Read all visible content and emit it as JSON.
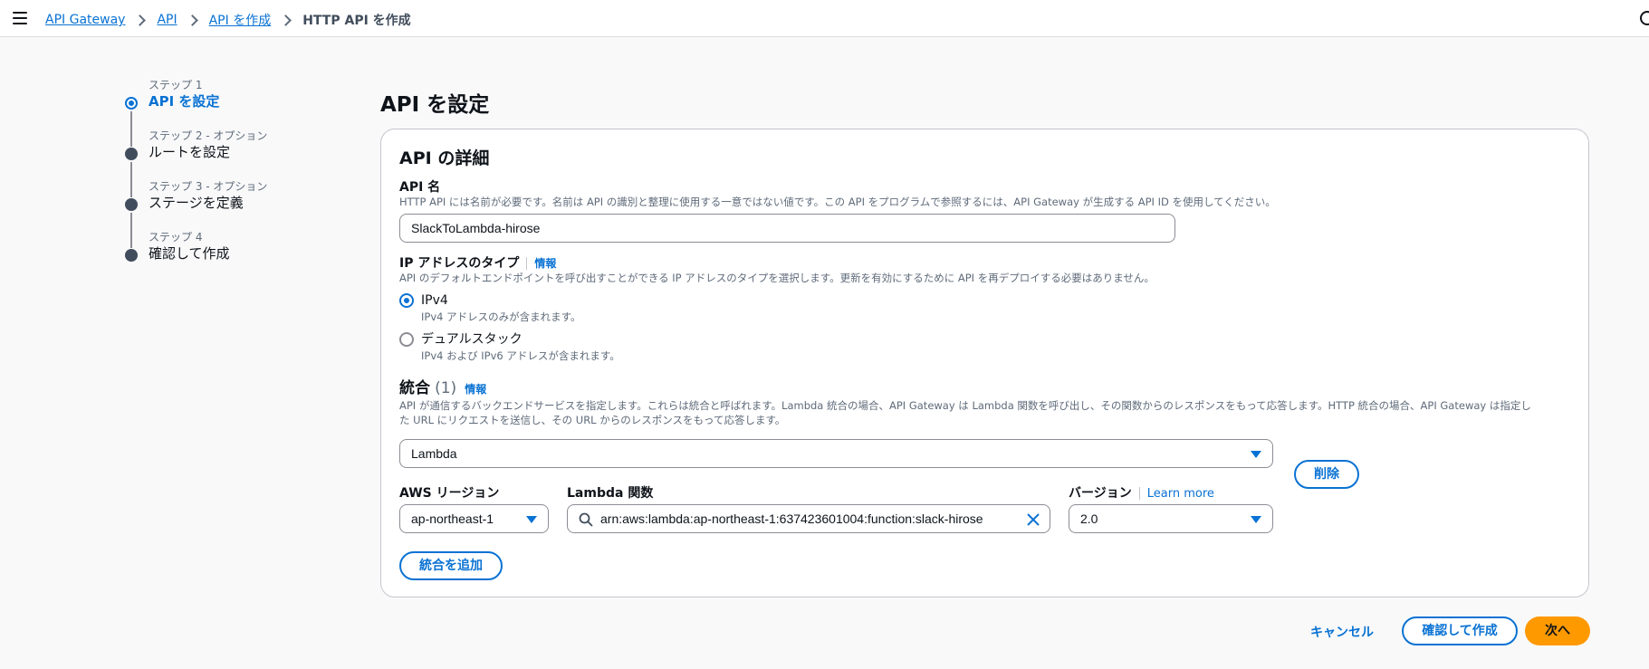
{
  "breadcrumb": {
    "items": [
      "API Gateway",
      "API",
      "API を作成"
    ],
    "current": "HTTP API を作成"
  },
  "steps": [
    {
      "meta": "ステップ 1",
      "title": "API を設定",
      "active": true
    },
    {
      "meta": "ステップ 2 - オプション",
      "title": "ルートを設定",
      "active": false
    },
    {
      "meta": "ステップ 3 - オプション",
      "title": "ステージを定義",
      "active": false
    },
    {
      "meta": "ステップ 4",
      "title": "確認して作成",
      "active": false
    }
  ],
  "page": {
    "title": "API を設定"
  },
  "details": {
    "title": "API の詳細",
    "api_name_label": "API 名",
    "api_name_desc": "HTTP API には名前が必要です。名前は API の識別と整理に使用する一意ではない値です。この API をプログラムで参照するには、API Gateway が生成する API ID を使用してください。",
    "api_name_value": "SlackToLambda-hirose",
    "ip_type_label": "IP アドレスのタイプ",
    "info": "情報",
    "ip_type_desc": "API のデフォルトエンドポイントを呼び出すことができる IP アドレスのタイプを選択します。更新を有効にするために API を再デプロイする必要はありません。",
    "ip_options": [
      {
        "label": "IPv4",
        "desc": "IPv4 アドレスのみが含まれます。",
        "checked": true
      },
      {
        "label": "デュアルスタック",
        "desc": "IPv4 および IPv6 アドレスが含まれます。",
        "checked": false
      }
    ],
    "integration_label": "統合",
    "integration_count": "(1)",
    "integration_desc_1": "API が通信するバックエンドサービスを指定します。これらは統合と呼ばれます。Lambda 統合の場合、API Gateway は Lambda 関数を呼び出し、その関数からのレスポンスをもって応答します。HTTP 統合の場合、API Gateway は指定し",
    "integration_desc_2": "た URL にリクエストを送信し、その URL からのレスポンスをもって応答します。",
    "integration_type": "Lambda",
    "delete_label": "削除",
    "region_label": "AWS リージョン",
    "region_value": "ap-northeast-1",
    "lambda_label": "Lambda 関数",
    "lambda_value": "arn:aws:lambda:ap-northeast-1:637423601004:function:slack-hirose",
    "version_label": "バージョン",
    "learn_more": "Learn more",
    "version_value": "2.0",
    "add_integration_label": "統合を追加"
  },
  "footer": {
    "cancel": "キャンセル",
    "review_create": "確認して作成",
    "next": "次へ"
  },
  "colors": {
    "accent": "#0972d3",
    "primary": "#ff9900"
  }
}
